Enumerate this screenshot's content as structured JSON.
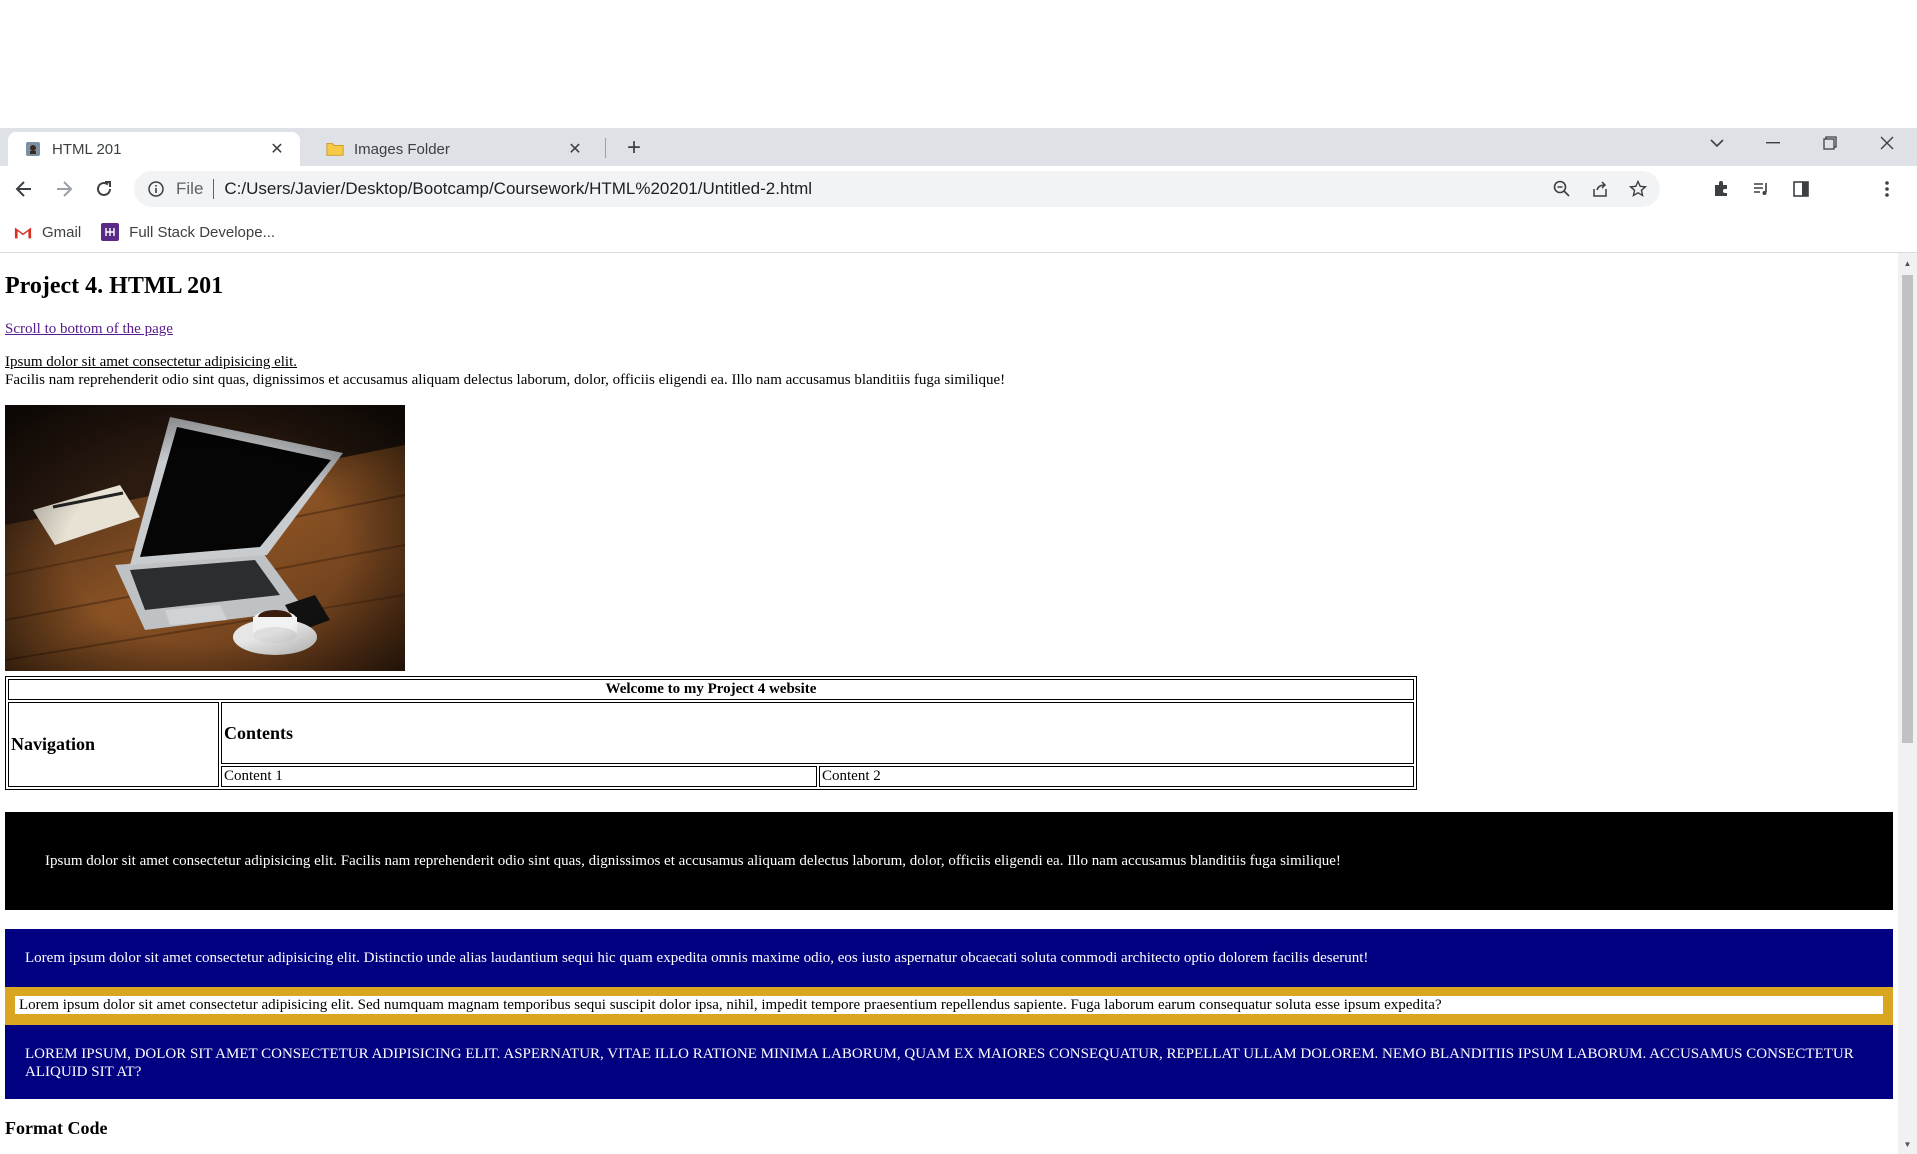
{
  "browser": {
    "tabs": [
      {
        "title": "HTML 201",
        "active": true,
        "favicon": "page-favicon-icon"
      },
      {
        "title": "Images Folder",
        "active": false,
        "favicon": "folder-icon"
      }
    ],
    "address": {
      "scheme_label": "File",
      "url": "C:/Users/Javier/Desktop/Bootcamp/Coursework/HTML%20201/Untitled-2.html"
    },
    "bookmarks": [
      {
        "label": "Gmail",
        "icon": "gmail-icon"
      },
      {
        "label": "Full Stack Develope...",
        "icon": "bookmark-app-icon"
      }
    ]
  },
  "page": {
    "title": "Project 4. HTML 201",
    "scroll_link": "Scroll to bottom of the page",
    "intro_link": "Ipsum dolor sit amet consectetur adipisicing elit.",
    "intro_text": "Facilis nam reprehenderit odio sint quas, dignissimos et accusamus aliquam delectus laborum, dolor, officiis eligendi ea. Illo nam accusamus blanditiis fuga similique!",
    "table": {
      "caption": "Welcome to my Project 4 website",
      "navigation": "Navigation",
      "contents": "Contents",
      "content1": "Content 1",
      "content2": "Content 2"
    },
    "black_box": "Ipsum dolor sit amet consectetur adipisicing elit. Facilis nam reprehenderit odio sint quas, dignissimos et accusamus aliquam delectus laborum, dolor, officiis eligendi ea. Illo nam accusamus blanditiis fuga similique!",
    "navy_box_1": "Lorem ipsum dolor sit amet consectetur adipisicing elit. Distinctio unde alias laudantium sequi hic quam expedita omnis maxime odio, eos iusto aspernatur obcaecati soluta commodi architecto optio dolorem facilis deserunt!",
    "gold_box": "Lorem ipsum dolor sit amet consectetur adipisicing elit. Sed numquam magnam temporibus sequi suscipit dolor ipsa, nihil, impedit tempore praesentium repellendus sapiente. Fuga laborum earum consequatur soluta esse ipsum expedita?",
    "navy_box_2": "LOREM IPSUM, DOLOR SIT AMET CONSECTETUR ADIPISICING ELIT. ASPERNATUR, VITAE ILLO RATIONE MINIMA LABORUM, QUAM EX MAIORES CONSEQUATUR, REPELLAT ULLAM DOLOREM. NEMO BLANDITIIS IPSUM LABORUM. ACCUSAMUS CONSECTETUR ALIQUID SIT AT?",
    "format_code": "Format Code"
  },
  "colors": {
    "tabstrip": "#dee1e6",
    "navy": "#000080",
    "gold": "#daa520",
    "link_visited": "#551a8b"
  }
}
